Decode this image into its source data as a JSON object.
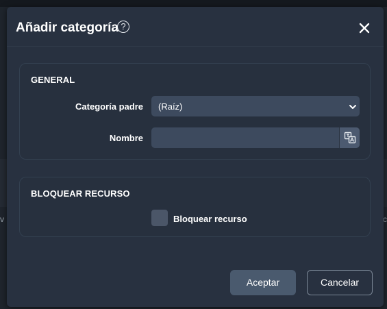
{
  "dialog": {
    "title": "Añadir categoría",
    "help_icon": "question-circle-icon",
    "close_icon": "close-icon"
  },
  "general": {
    "heading": "GENERAL",
    "parent_label": "Categoría padre",
    "parent_value": "(Raíz)",
    "name_label": "Nombre",
    "name_value": "",
    "translate_icon": "translate-icon"
  },
  "lock": {
    "heading": "BLOQUEAR RECURSO",
    "checkbox_label": "Bloquear recurso",
    "checked": false
  },
  "buttons": {
    "accept": "Aceptar",
    "cancel": "Cancelar"
  },
  "background": {
    "left_fragment": "v",
    "right_fragment": "c"
  },
  "colors": {
    "dialog_bg": "#283140",
    "field_bg": "#3d4a5e",
    "accept_bg": "#4a5a6e"
  }
}
